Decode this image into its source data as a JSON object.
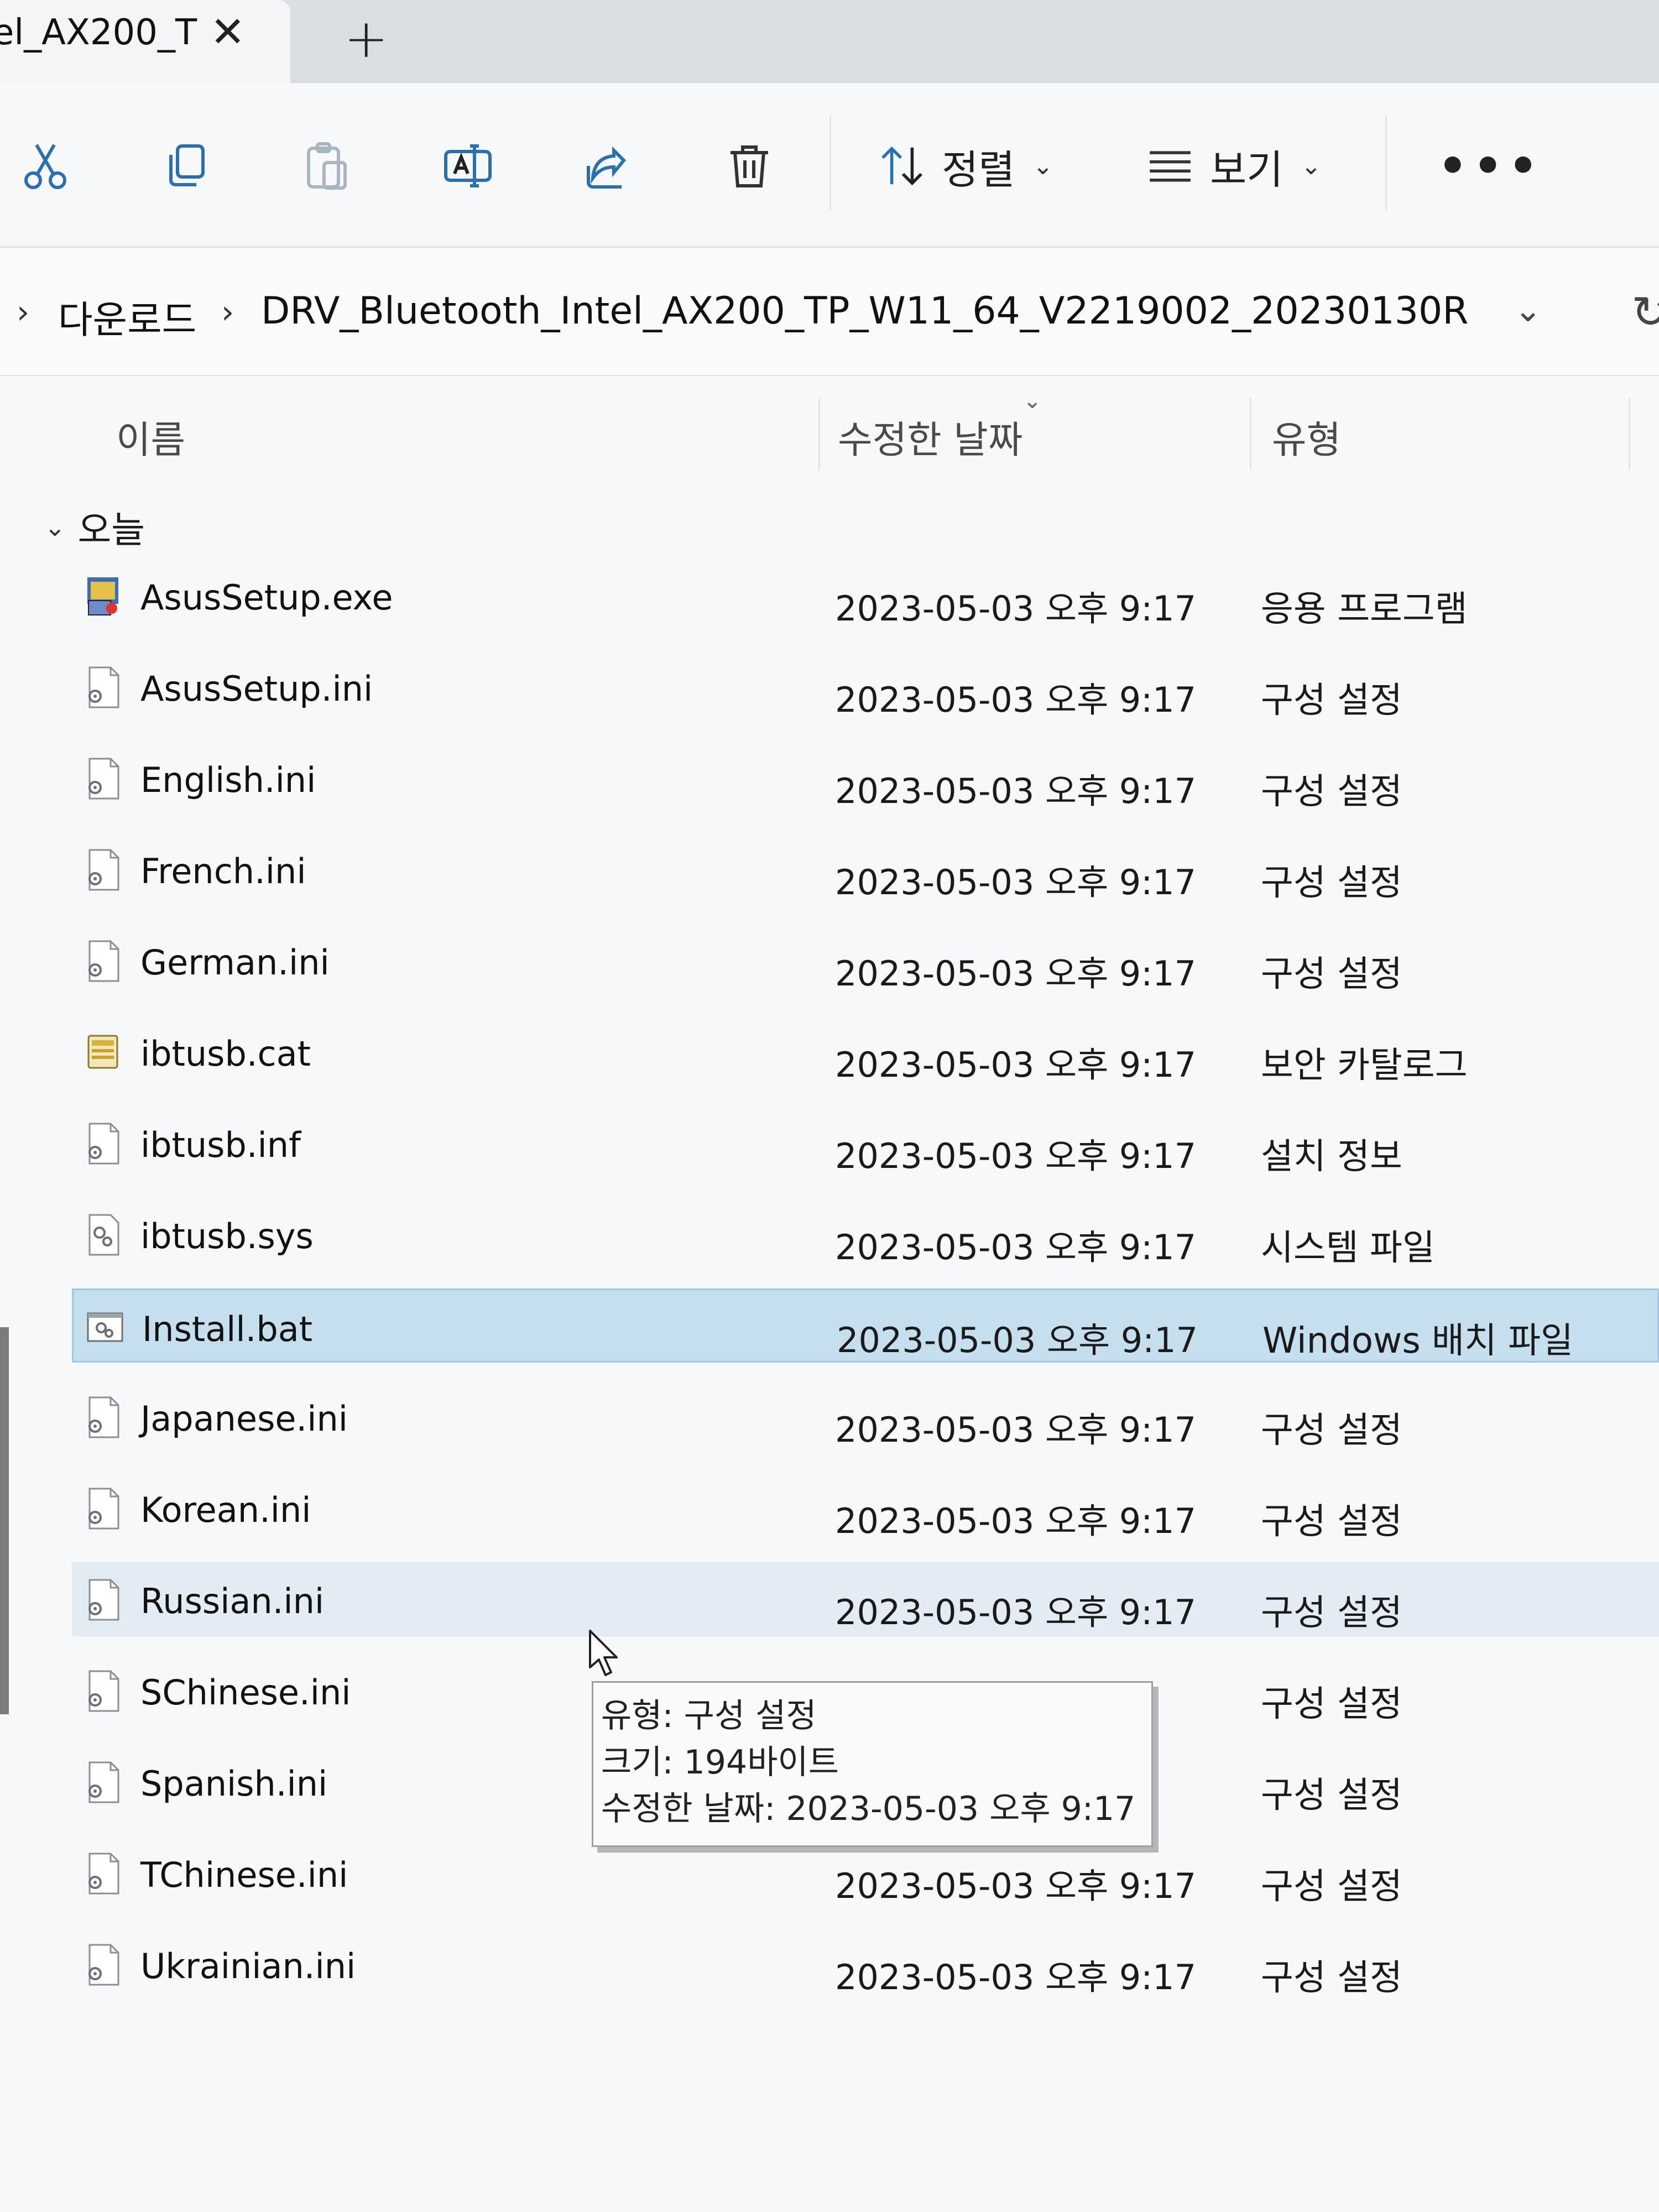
{
  "tab": {
    "title": "el_AX200_T",
    "close_glyph": "✕",
    "new_glyph": "+"
  },
  "toolbar": {
    "buttons": [
      {
        "icon": "cut-icon"
      },
      {
        "icon": "copy-icon"
      },
      {
        "icon": "paste-icon"
      },
      {
        "icon": "rename-icon"
      },
      {
        "icon": "share-icon"
      },
      {
        "icon": "delete-icon"
      }
    ],
    "sort_label": "정렬",
    "view_label": "보기",
    "more_label": "•••"
  },
  "address": {
    "crumbs": [
      "다운로드",
      "DRV_Bluetooth_Intel_AX200_TP_W11_64_V2219002_20230130R"
    ]
  },
  "columns": {
    "name": "이름",
    "date": "수정한 날짜",
    "type": "유형"
  },
  "group": {
    "label": "오늘"
  },
  "files": [
    {
      "name": "AsusSetup.exe",
      "date": "2023-05-03 오후 9:17",
      "type": "응용 프로그램",
      "icon": "exe-setup-icon"
    },
    {
      "name": "AsusSetup.ini",
      "date": "2023-05-03 오후 9:17",
      "type": "구성 설정",
      "icon": "ini-settings-icon"
    },
    {
      "name": "English.ini",
      "date": "2023-05-03 오후 9:17",
      "type": "구성 설정",
      "icon": "ini-settings-icon"
    },
    {
      "name": "French.ini",
      "date": "2023-05-03 오후 9:17",
      "type": "구성 설정",
      "icon": "ini-settings-icon"
    },
    {
      "name": "German.ini",
      "date": "2023-05-03 오후 9:17",
      "type": "구성 설정",
      "icon": "ini-settings-icon"
    },
    {
      "name": "ibtusb.cat",
      "date": "2023-05-03 오후 9:17",
      "type": "보안 카탈로그",
      "icon": "security-catalog-icon"
    },
    {
      "name": "ibtusb.inf",
      "date": "2023-05-03 오후 9:17",
      "type": "설치 정보",
      "icon": "ini-settings-icon"
    },
    {
      "name": "ibtusb.sys",
      "date": "2023-05-03 오후 9:17",
      "type": "시스템 파일",
      "icon": "system-file-icon"
    },
    {
      "name": "Install.bat",
      "date": "2023-05-03 오후 9:17",
      "type": "Windows 배치 파일",
      "icon": "batch-file-icon",
      "state": "selected"
    },
    {
      "name": "Japanese.ini",
      "date": "2023-05-03 오후 9:17",
      "type": "구성 설정",
      "icon": "ini-settings-icon"
    },
    {
      "name": "Korean.ini",
      "date": "2023-05-03 오후 9:17",
      "type": "구성 설정",
      "icon": "ini-settings-icon"
    },
    {
      "name": "Russian.ini",
      "date": "2023-05-03 오후 9:17",
      "type": "구성 설정",
      "icon": "ini-settings-icon",
      "state": "hover"
    },
    {
      "name": "SChinese.ini",
      "date": "",
      "type": "구성 설정",
      "icon": "ini-settings-icon"
    },
    {
      "name": "Spanish.ini",
      "date": "",
      "type": "구성 설정",
      "icon": "ini-settings-icon"
    },
    {
      "name": "TChinese.ini",
      "date": "2023-05-03 오후 9:17",
      "type": "구성 설정",
      "icon": "ini-settings-icon"
    },
    {
      "name": "Ukrainian.ini",
      "date": "2023-05-03 오후 9:17",
      "type": "구성 설정",
      "icon": "ini-settings-icon"
    }
  ],
  "tooltip": {
    "type_line": "유형: 구성 설정",
    "size_line": "크기: 194바이트",
    "date_line": "수정한 날짜: 2023-05-03 오후 9:17"
  },
  "colors": {
    "selected_bg": "#c6dfee",
    "hover_bg": "#e3ecf2",
    "window_bg": "#f7f8f9"
  }
}
